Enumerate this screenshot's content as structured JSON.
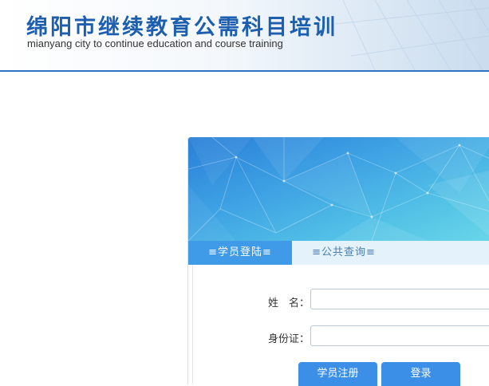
{
  "header": {
    "title": "绵阳市继续教育公需科目培训",
    "subtitle": "mianyang city to continue education and course training"
  },
  "tabs": [
    {
      "label": "≡学员登陆≡",
      "active": true
    },
    {
      "label": "≡公共查询≡",
      "active": false
    }
  ],
  "form": {
    "name_label": "姓　名：",
    "name_value": "",
    "id_label": "身份证：",
    "id_value": ""
  },
  "buttons": {
    "register": "学员注册",
    "login": "登录"
  },
  "colors": {
    "brand": "#1d5fae",
    "tab_active": "#3f9ae8",
    "button": "#3b8fe6"
  }
}
